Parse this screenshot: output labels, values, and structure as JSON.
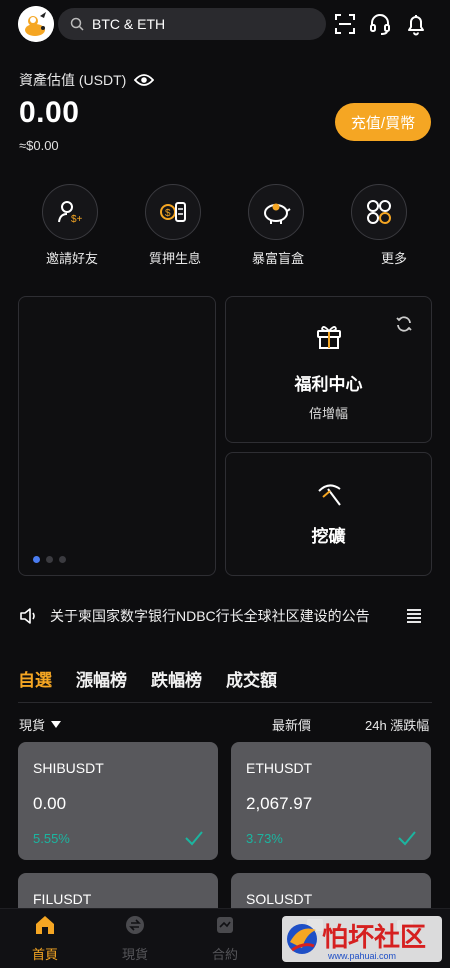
{
  "header": {
    "search_placeholder": "BTC & ETH",
    "icons": [
      "scan-icon",
      "headset-icon",
      "bell-icon"
    ]
  },
  "balance": {
    "label": "資產估值 (USDT)",
    "value": "0.00",
    "fiat": "≈$0.00",
    "deposit_button": "充值/買幣"
  },
  "quick_actions": [
    {
      "label": "邀請好友",
      "icon": "invite-user-icon"
    },
    {
      "label": "質押生息",
      "icon": "staking-coin-icon"
    },
    {
      "label": "暴富盲盒",
      "icon": "piggy-bank-icon"
    },
    {
      "label": "更多",
      "icon": "more-grid-icon"
    }
  ],
  "welfare_card": {
    "title": "福利中心",
    "subtitle": "倍增幅"
  },
  "mining_card": {
    "title": "挖礦"
  },
  "announcement": {
    "text": "关于柬国家数字银行NDBC行长全球社区建设的公告"
  },
  "tabs": [
    "自選",
    "漲幅榜",
    "跌幅榜",
    "成交額"
  ],
  "active_tab": 0,
  "columns": {
    "market": "現貨",
    "price": "最新價",
    "change": "24h 漲跌幅"
  },
  "markets": [
    {
      "symbol": "SHIBUSDT",
      "price": "0.00",
      "change": "5.55%"
    },
    {
      "symbol": "ETHUSDT",
      "price": "2,067.97",
      "change": "3.73%"
    },
    {
      "symbol": "FILUSDT"
    },
    {
      "symbol": "SOLUSDT"
    }
  ],
  "bottom_nav": [
    {
      "label": "首頁",
      "icon": "home-icon"
    },
    {
      "label": "現貨",
      "icon": "spot-exchange-icon"
    },
    {
      "label": "合約",
      "icon": "contract-icon"
    },
    {
      "label": "",
      "icon": "trade-icon"
    },
    {
      "label": "",
      "icon": "wallet-icon"
    }
  ],
  "active_nav": 0,
  "watermark": {
    "text": "怕坏社区",
    "url_text": "www.pahuai.com"
  },
  "colors": {
    "accent": "#f5a623",
    "positive": "#1bb5a0",
    "background": "#0d0d0f",
    "card": "#58585c"
  }
}
